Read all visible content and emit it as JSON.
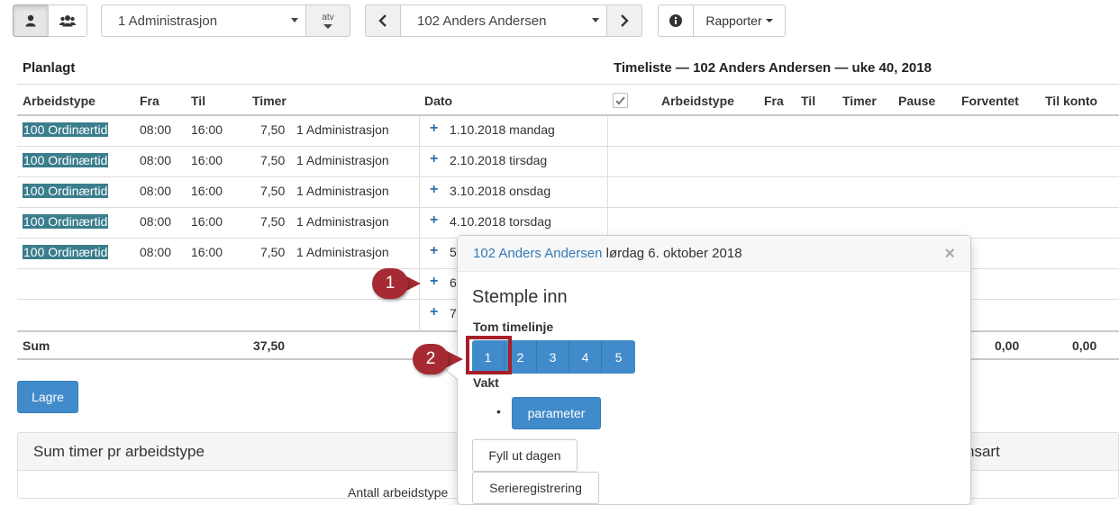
{
  "toolbar": {
    "user_icon": "user-icon",
    "group_icon": "users-icon",
    "department_select": "1 Administrasjon",
    "atv_label": "atv",
    "prev_icon": "chevron-left-icon",
    "employee_select": "102 Anders Andersen",
    "next_icon": "chevron-right-icon",
    "info_icon": "info-icon",
    "reports_label": "Rapporter"
  },
  "planned": {
    "title": "Planlagt",
    "columns": [
      "Arbeidstype",
      "Fra",
      "Til",
      "Timer",
      "Dato"
    ],
    "rows": [
      {
        "type": "100 Ordinærtid",
        "from": "08:00",
        "to": "16:00",
        "hours": "7,50",
        "dept": "1 Administrasjon",
        "date": "1.10.2018 mandag"
      },
      {
        "type": "100 Ordinærtid",
        "from": "08:00",
        "to": "16:00",
        "hours": "7,50",
        "dept": "1 Administrasjon",
        "date": "2.10.2018 tirsdag"
      },
      {
        "type": "100 Ordinærtid",
        "from": "08:00",
        "to": "16:00",
        "hours": "7,50",
        "dept": "1 Administrasjon",
        "date": "3.10.2018 onsdag"
      },
      {
        "type": "100 Ordinærtid",
        "from": "08:00",
        "to": "16:00",
        "hours": "7,50",
        "dept": "1 Administrasjon",
        "date": "4.10.2018 torsdag"
      },
      {
        "type": "100 Ordinærtid",
        "from": "08:00",
        "to": "16:00",
        "hours": "7,50",
        "dept": "1 Administrasjon",
        "date": "5"
      },
      {
        "type": "",
        "from": "",
        "to": "",
        "hours": "",
        "dept": "",
        "date": "6"
      },
      {
        "type": "",
        "from": "",
        "to": "",
        "hours": "",
        "dept": "",
        "date": "7"
      }
    ],
    "sum_label": "Sum",
    "sum_hours": "37,50"
  },
  "timesheet": {
    "title": "Timeliste — 102 Anders Andersen — uke 40, 2018",
    "columns": [
      "Arbeidstype",
      "Fra",
      "Til",
      "Timer",
      "Pause",
      "Forventet",
      "Til konto"
    ],
    "sum_expected": "0,00",
    "sum_account": "0,00"
  },
  "save_label": "Lagre",
  "summary_panel": {
    "title": "Sum timer pr arbeidstype",
    "right_fragment": "nsart",
    "column_fragment": "Antall arbeidstype"
  },
  "popover": {
    "employee_link": "102 Anders Andersen",
    "date_text": " lørdag 6. oktober 2018",
    "close": "×",
    "heading": "Stemple inn",
    "timeline_label": "Tom timelinje",
    "timeline_options": [
      "1",
      "2",
      "3",
      "4",
      "5"
    ],
    "shift_label": "Vakt",
    "bullet": "•",
    "parameter_label": "parameter",
    "fill_day_label": "Fyll ut dagen",
    "series_label": "Serieregistrering"
  },
  "callouts": [
    "1",
    "2"
  ],
  "colors": {
    "primary": "#428bca",
    "tag": "#3a7d8c",
    "callout": "#a52a33",
    "link": "#2f6fa8"
  }
}
